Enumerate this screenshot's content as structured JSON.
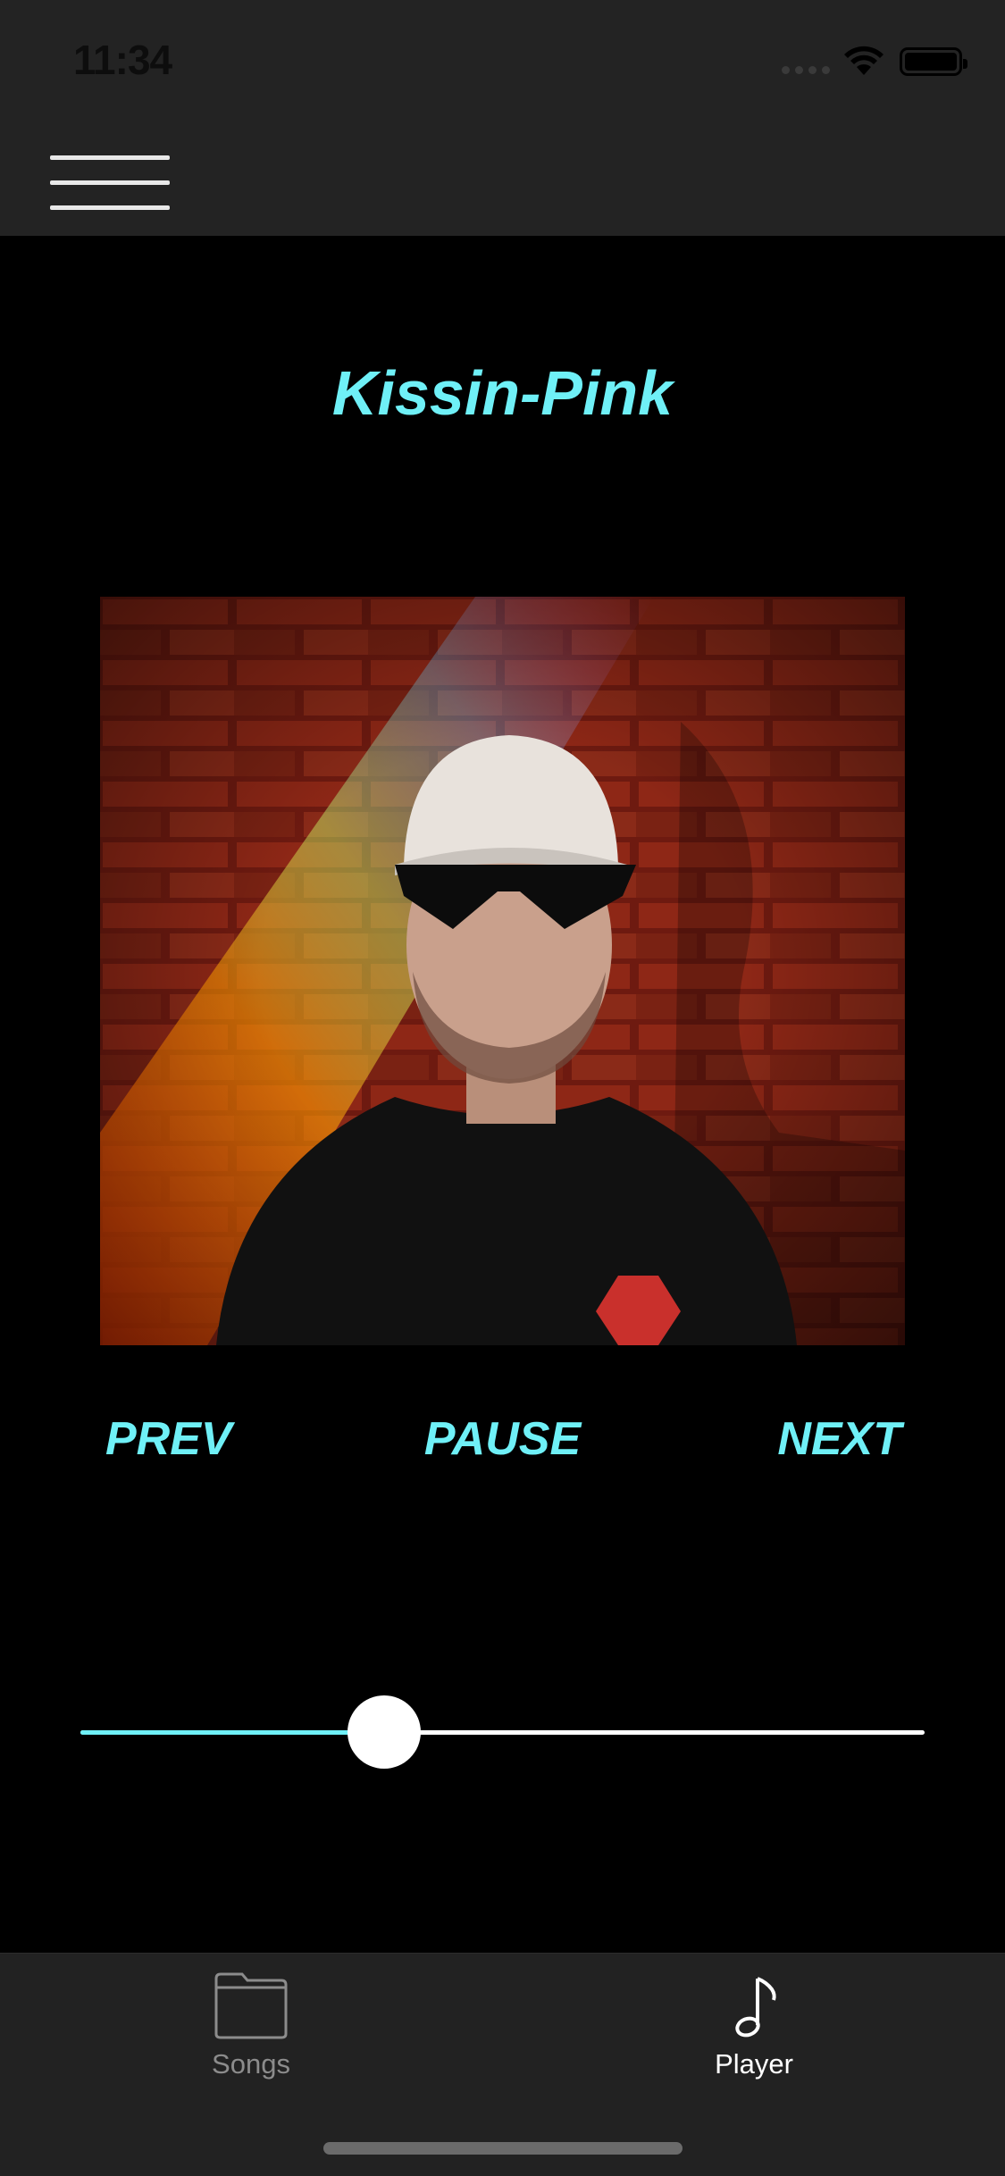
{
  "status_bar": {
    "time": "11:34",
    "icons": [
      "cellular-signal-icon",
      "wifi-icon",
      "battery-icon"
    ]
  },
  "nav_bar": {
    "menu_icon": "hamburger-menu-icon"
  },
  "player": {
    "song_title": "Kissin-Pink",
    "album_art": "artist-photo",
    "controls": {
      "prev_label": "PREV",
      "pause_label": "PAUSE",
      "next_label": "NEXT"
    },
    "progress": 0.36
  },
  "tab_bar": {
    "tabs": [
      {
        "label": "Songs",
        "icon": "folder-icon",
        "selected": false
      },
      {
        "label": "Player",
        "icon": "music-note-icon",
        "selected": true
      }
    ]
  },
  "colors": {
    "accent": "#6ff0f7",
    "background": "#000000",
    "bar_background": "#232323",
    "inactive_tab": "#8c8c8c",
    "active_tab": "#ffffff"
  }
}
